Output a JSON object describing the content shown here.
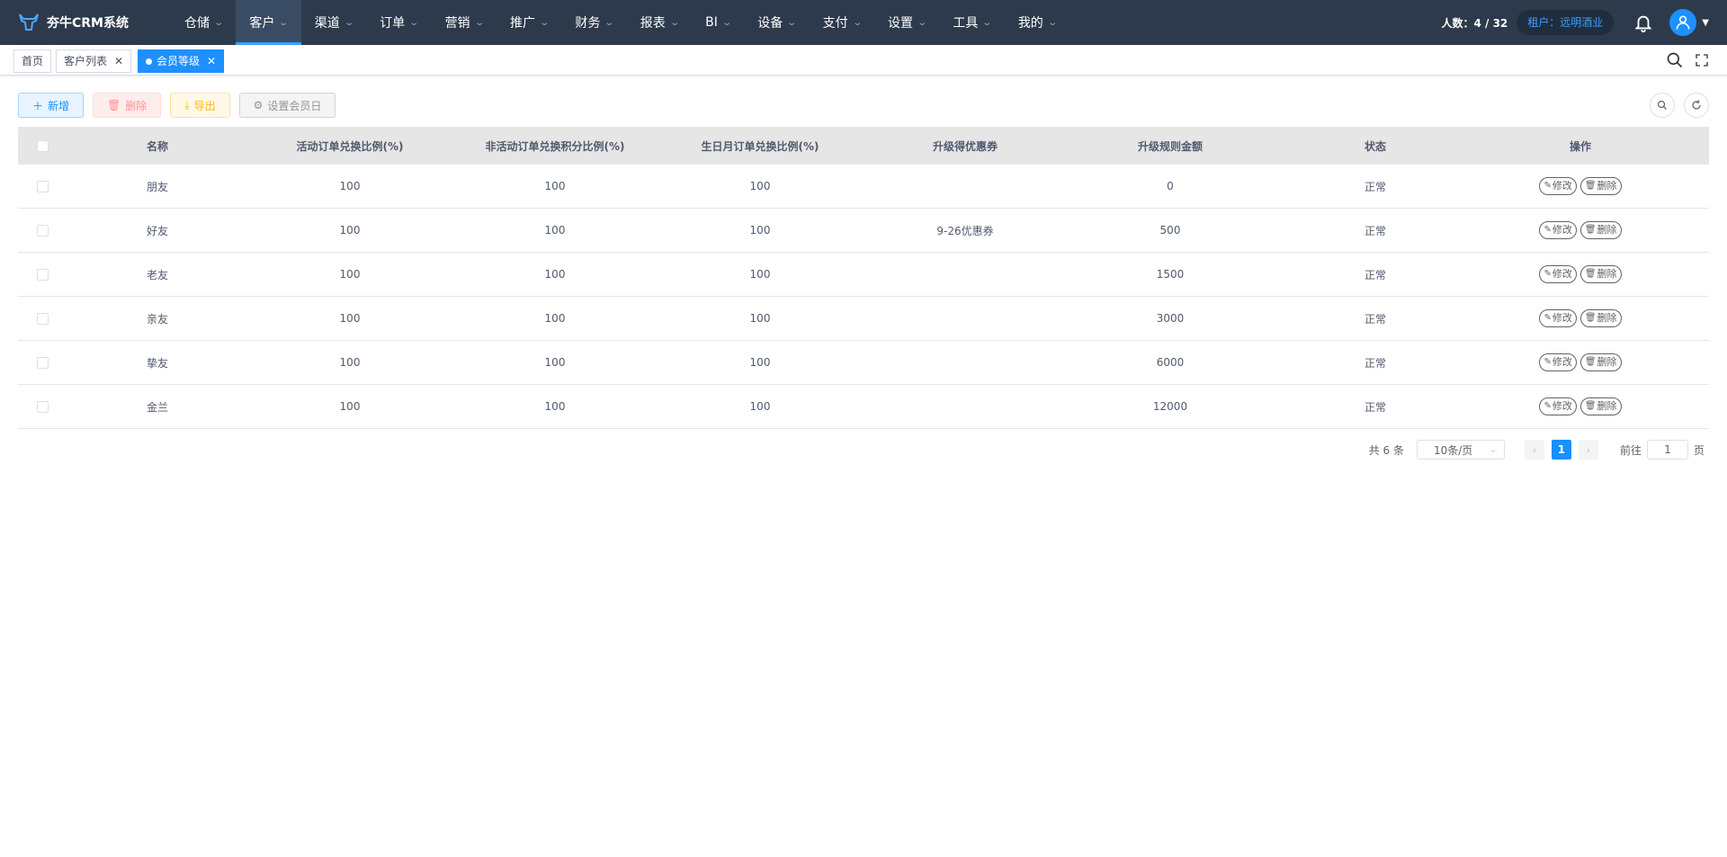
{
  "app": {
    "title": "夯牛CRM系统"
  },
  "menu": [
    {
      "label": "仓储"
    },
    {
      "label": "客户"
    },
    {
      "label": "渠道"
    },
    {
      "label": "订单"
    },
    {
      "label": "营销"
    },
    {
      "label": "推广"
    },
    {
      "label": "财务"
    },
    {
      "label": "报表"
    },
    {
      "label": "BI"
    },
    {
      "label": "设备"
    },
    {
      "label": "支付"
    },
    {
      "label": "设置"
    },
    {
      "label": "工具"
    },
    {
      "label": "我的"
    }
  ],
  "header": {
    "people": "人数：4 / 32",
    "tenant": "租户：远明酒业"
  },
  "tags": [
    {
      "label": "首页"
    },
    {
      "label": "客户列表"
    },
    {
      "label": "会员等级"
    }
  ],
  "toolbar": {
    "add": "新增",
    "delete": "删除",
    "export": "导出",
    "member_day": "设置会员日"
  },
  "table": {
    "headers": [
      "名称",
      "活动订单兑换比例(%)",
      "非活动订单兑换积分比例(%)",
      "生日月订单兑换比例(%)",
      "升级得优惠券",
      "升级规则金额",
      "状态",
      "操作"
    ],
    "rows": [
      [
        "朋友",
        "100",
        "100",
        "100",
        "",
        "0",
        "正常"
      ],
      [
        "好友",
        "100",
        "100",
        "100",
        "9-26优惠券",
        "500",
        "正常"
      ],
      [
        "老友",
        "100",
        "100",
        "100",
        "",
        "1500",
        "正常"
      ],
      [
        "亲友",
        "100",
        "100",
        "100",
        "",
        "3000",
        "正常"
      ],
      [
        "挚友",
        "100",
        "100",
        "100",
        "",
        "6000",
        "正常"
      ],
      [
        "金兰",
        "100",
        "100",
        "100",
        "",
        "12000",
        "正常"
      ]
    ],
    "edit_label": "修改",
    "delete_label": "删除"
  },
  "pager": {
    "total": "共 6 条",
    "page_size": "10条/页",
    "current_page": "1",
    "goto": "前往",
    "goto_value": "1",
    "page_unit": "页"
  },
  "colors": {
    "nav_bg": "#2d3a4b",
    "accent": "#1e90ff"
  }
}
